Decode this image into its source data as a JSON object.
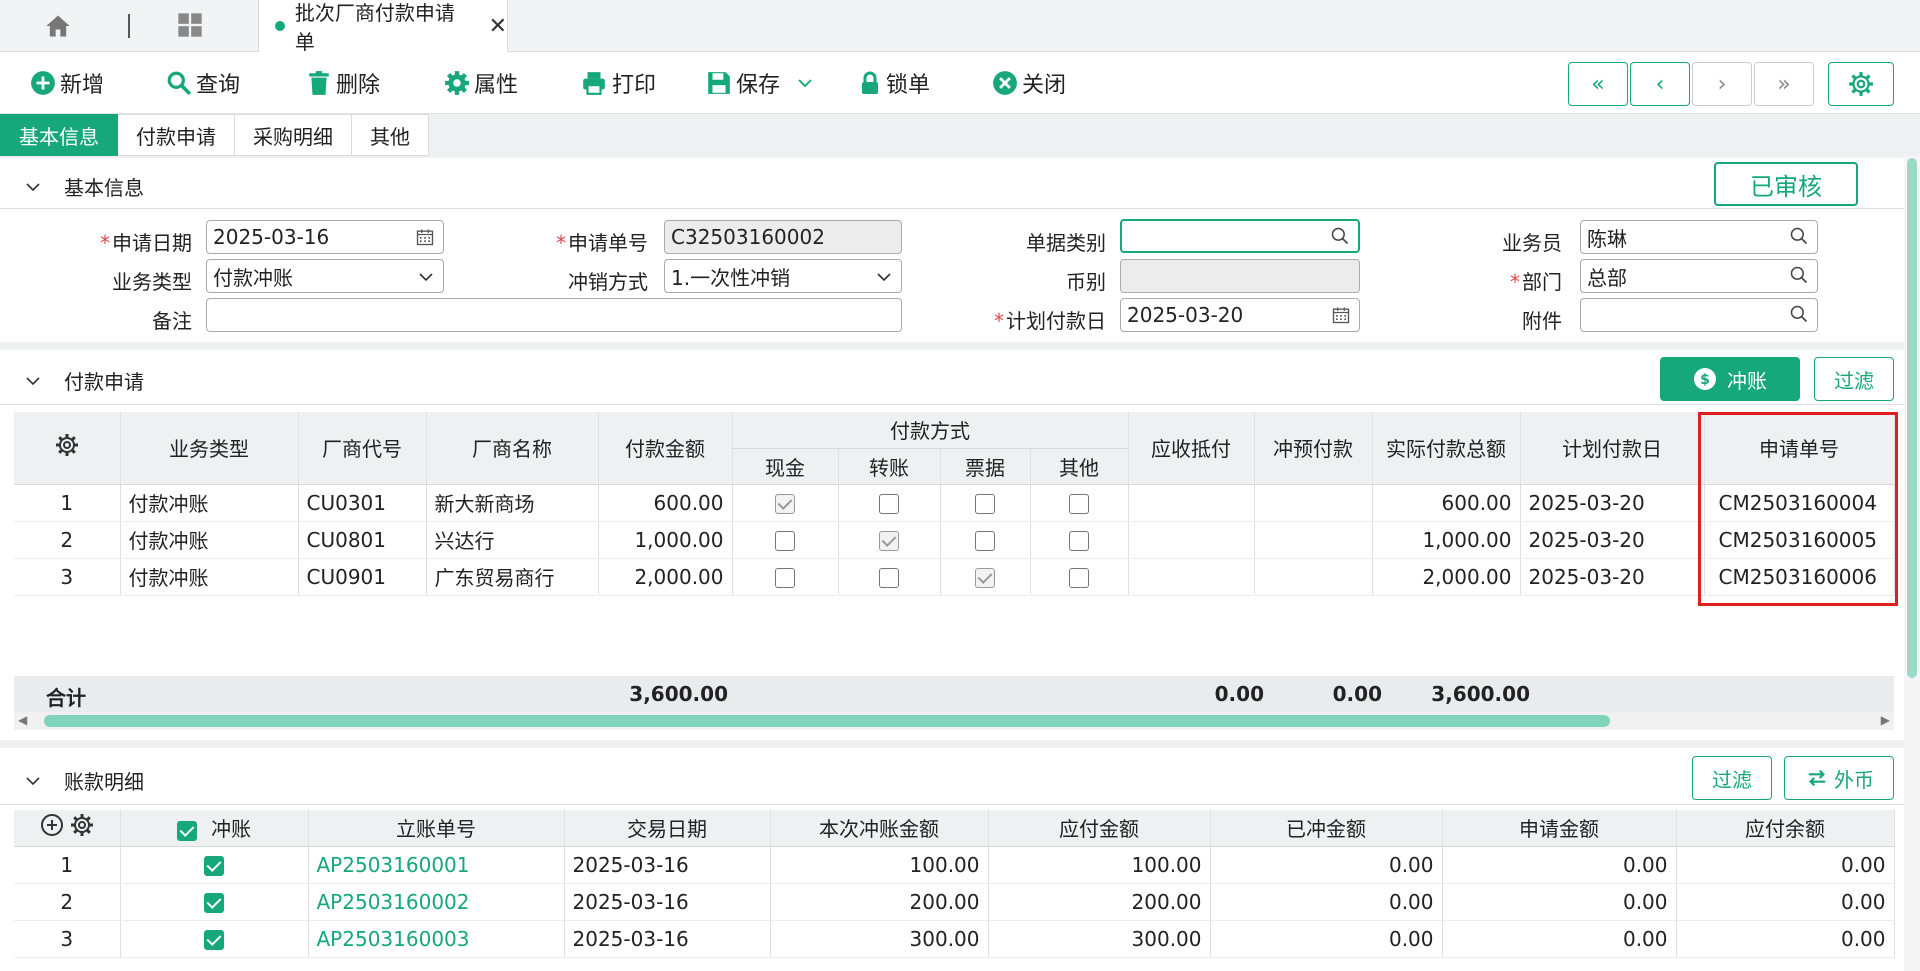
{
  "topbar": {
    "doc_tab_title": "批次厂商付款申请单"
  },
  "toolbar": {
    "buttons": [
      {
        "label": "新增",
        "icon": "plus-circle-icon"
      },
      {
        "label": "查询",
        "icon": "search-icon"
      },
      {
        "label": "删除",
        "icon": "trash-icon"
      },
      {
        "label": "属性",
        "icon": "gear-icon"
      },
      {
        "label": "打印",
        "icon": "printer-icon"
      },
      {
        "label": "保存",
        "icon": "save-icon"
      },
      {
        "label": "锁单",
        "icon": "lock-icon"
      },
      {
        "label": "关闭",
        "icon": "close-circle-icon"
      }
    ],
    "nav": [
      "«",
      "‹",
      "›",
      "»"
    ]
  },
  "section_tabs": [
    "基本信息",
    "付款申请",
    "采购明细",
    "其他"
  ],
  "basic": {
    "title": "基本信息",
    "status_badge": "已审核",
    "fields": {
      "apply_date_label": "申请日期",
      "apply_date": "2025-03-16",
      "biz_type_label": "业务类型",
      "biz_type": "付款冲账",
      "remark_label": "备注",
      "remark": "",
      "apply_no_label": "申请单号",
      "apply_no": "C32503160002",
      "offset_method_label": "冲销方式",
      "offset_method": "1.一次性冲销",
      "doc_type_label": "单据类别",
      "doc_type": "",
      "currency_label": "币别",
      "currency": "",
      "plan_pay_date_label": "计划付款日",
      "plan_pay_date": "2025-03-20",
      "salesman_label": "业务员",
      "salesman": "陈琳",
      "dept_label": "部门",
      "dept": "总部",
      "attachment_label": "附件",
      "attachment": ""
    }
  },
  "payment": {
    "title": "付款申请",
    "offset_button": "冲账",
    "filter_button": "过滤",
    "headers": {
      "biz_type": "业务类型",
      "vendor_code": "厂商代号",
      "vendor_name": "厂商名称",
      "pay_amount": "付款金额",
      "pay_method": "付款方式",
      "cash": "现金",
      "transfer": "转账",
      "bill": "票据",
      "other": "其他",
      "recv_offset": "应收抵付",
      "prepay_offset": "冲预付款",
      "actual_total": "实际付款总额",
      "plan_date": "计划付款日",
      "apply_no": "申请单号"
    },
    "rows": [
      {
        "no": "1",
        "biz_type": "付款冲账",
        "vendor_code": "CU0301",
        "vendor_name": "新大新商场",
        "pay_amount": "600.00",
        "method": "cash",
        "recv_offset": "",
        "prepay_offset": "",
        "actual_total": "600.00",
        "plan_date": "2025-03-20",
        "apply_no": "CM2503160004"
      },
      {
        "no": "2",
        "biz_type": "付款冲账",
        "vendor_code": "CU0801",
        "vendor_name": "兴达行",
        "pay_amount": "1,000.00",
        "method": "transfer",
        "recv_offset": "",
        "prepay_offset": "",
        "actual_total": "1,000.00",
        "plan_date": "2025-03-20",
        "apply_no": "CM2503160005"
      },
      {
        "no": "3",
        "biz_type": "付款冲账",
        "vendor_code": "CU0901",
        "vendor_name": "广东贸易商行",
        "pay_amount": "2,000.00",
        "method": "bill",
        "recv_offset": "",
        "prepay_offset": "",
        "actual_total": "2,000.00",
        "plan_date": "2025-03-20",
        "apply_no": "CM2503160006"
      }
    ],
    "total_label": "合计",
    "totals": {
      "pay_amount": "3,600.00",
      "recv_offset": "0.00",
      "prepay_offset": "0.00",
      "actual_total": "3,600.00"
    }
  },
  "ledger": {
    "title": "账款明细",
    "filter_button": "过滤",
    "currency_button": "外币",
    "headers": {
      "offset": "冲账",
      "ledger_no": "立账单号",
      "trade_date": "交易日期",
      "this_offset": "本次冲账金额",
      "payable": "应付金额",
      "offset_done": "已冲金额",
      "apply_amount": "申请金额",
      "payable_balance": "应付余额"
    },
    "rows": [
      {
        "no": "1",
        "ledger_no": "AP2503160001",
        "trade_date": "2025-03-16",
        "this_offset": "100.00",
        "payable": "100.00",
        "offset_done": "0.00",
        "apply_amount": "0.00",
        "payable_balance": "0.00"
      },
      {
        "no": "2",
        "ledger_no": "AP2503160002",
        "trade_date": "2025-03-16",
        "this_offset": "200.00",
        "payable": "200.00",
        "offset_done": "0.00",
        "apply_amount": "0.00",
        "payable_balance": "0.00"
      },
      {
        "no": "3",
        "ledger_no": "AP2503160003",
        "trade_date": "2025-03-16",
        "this_offset": "300.00",
        "payable": "300.00",
        "offset_done": "0.00",
        "apply_amount": "0.00",
        "payable_balance": "0.00"
      }
    ]
  },
  "colors": {
    "accent": "#16a77b",
    "required": "#e04848",
    "highlight_box": "#e02020"
  }
}
